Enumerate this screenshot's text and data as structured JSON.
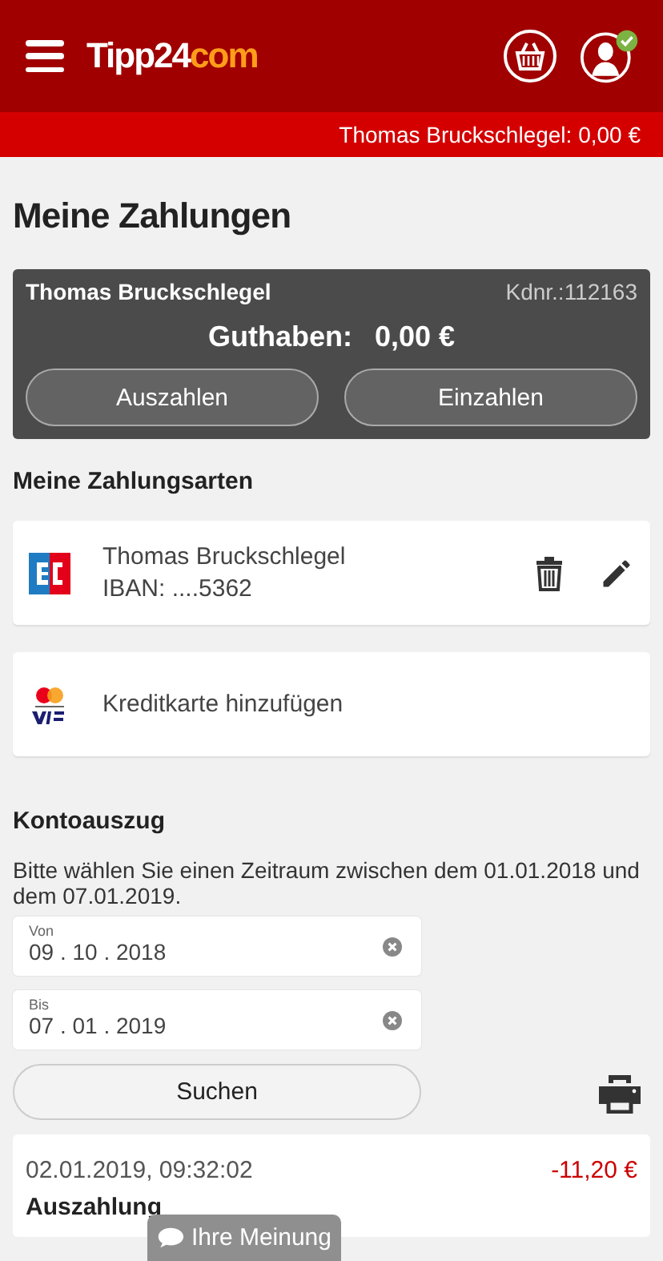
{
  "header": {
    "logo_main": "Tipp24",
    "logo_suffix": "com"
  },
  "account_bar": {
    "text": "Thomas Bruckschlegel: 0,00 €"
  },
  "title": "Meine Zahlungen",
  "account_card": {
    "name": "Thomas Bruckschlegel",
    "customer_number": "Kdnr.:112163",
    "balance_label": "Guthaben:",
    "balance": "0,00 €",
    "buttons": [
      "Auszahlen",
      "Einzahlen"
    ]
  },
  "payment_methods": {
    "heading": "Meine Zahlungsarten",
    "items": [
      {
        "kind": "ec",
        "lines": [
          "Thomas Bruckschlegel",
          "IBAN: ....5362"
        ],
        "editable": true
      },
      {
        "kind": "card",
        "lines": [
          "Kreditkarte hinzufügen"
        ],
        "editable": false
      }
    ]
  },
  "statement": {
    "heading": "Kontoauszug",
    "hint": "Bitte wählen Sie einen Zeitraum zwischen dem 01.01.2018 und dem 07.01.2019.",
    "fields": [
      {
        "label": "Von",
        "value": "09 . 10 . 2018"
      },
      {
        "label": "Bis",
        "value": "07 . 01 . 2019"
      }
    ],
    "search_button": "Suchen",
    "transactions": [
      {
        "datetime": "02.01.2019, 09:32:02",
        "amount": "-11,20 €",
        "type": "Auszahlung"
      }
    ]
  },
  "feedback_button": "Ihre Meinung"
}
